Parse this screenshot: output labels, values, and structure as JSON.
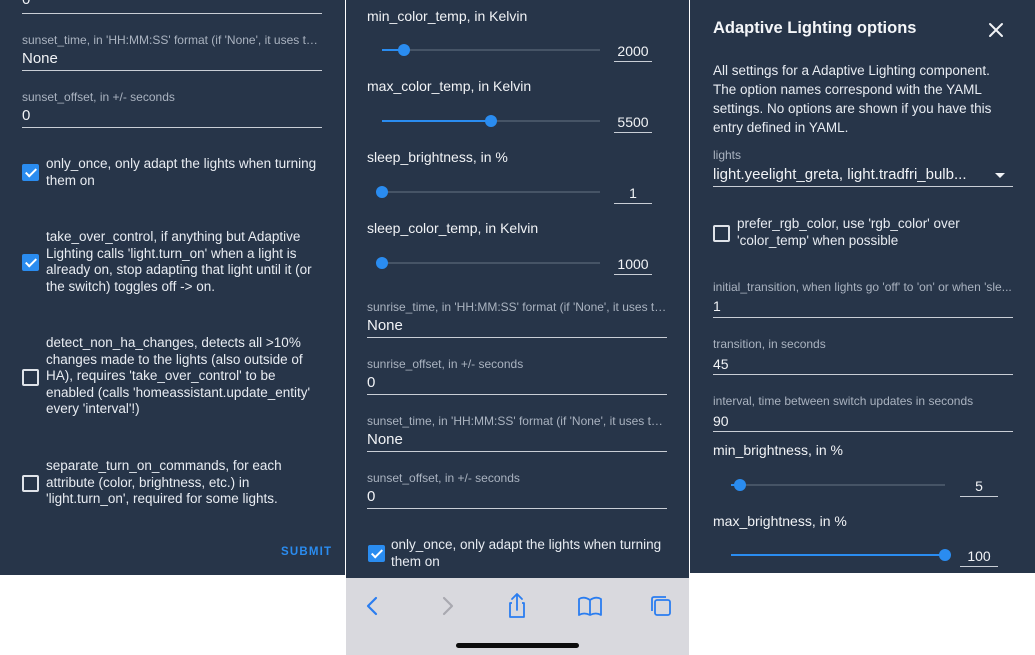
{
  "panel1": {
    "top_value": "0",
    "sunset_time": {
      "label": "sunset_time, in 'HH:MM:SS' format (if 'None', it uses the...",
      "value": "None"
    },
    "sunset_offset": {
      "label": "sunset_offset, in +/- seconds",
      "value": "0"
    },
    "only_once": {
      "checked": true,
      "lines": [
        "only_once, only adapt the lights when turning",
        "them on"
      ]
    },
    "take_over_control": {
      "checked": true,
      "lines": [
        "take_over_control, if anything but Adaptive",
        "Lighting calls 'light.turn_on' when a light is",
        "already on, stop adapting that light until it (or",
        "the switch) toggles off -> on."
      ]
    },
    "detect_non_ha_changes": {
      "checked": false,
      "lines": [
        "detect_non_ha_changes, detects all >10%",
        "changes made to the lights (also outside of",
        "HA), requires 'take_over_control' to be",
        "enabled (calls 'homeassistant.update_entity'",
        "every 'interval'!)"
      ]
    },
    "separate_turn_on_commands": {
      "checked": false,
      "lines": [
        "separate_turn_on_commands, for each",
        "attribute (color, brightness, etc.) in",
        "'light.turn_on', required for some lights."
      ]
    },
    "submit_label": "SUBMIT"
  },
  "panel2": {
    "min_color_temp": {
      "label": "min_color_temp, in Kelvin",
      "value": "2000",
      "fraction": 0.1
    },
    "max_color_temp": {
      "label": "max_color_temp, in Kelvin",
      "value": "5500",
      "fraction": 0.5
    },
    "sleep_brightness": {
      "label": "sleep_brightness, in %",
      "value": "1",
      "fraction": 0.0
    },
    "sleep_color_temp": {
      "label": "sleep_color_temp, in Kelvin",
      "value": "1000",
      "fraction": 0.0
    },
    "sunrise_time": {
      "label": "sunrise_time, in 'HH:MM:SS' format (if 'None', it uses th...",
      "value": "None"
    },
    "sunrise_offset": {
      "label": "sunrise_offset, in +/- seconds",
      "value": "0"
    },
    "sunset_time": {
      "label": "sunset_time, in 'HH:MM:SS' format (if 'None', it uses the...",
      "value": "None"
    },
    "sunset_offset": {
      "label": "sunset_offset, in +/- seconds",
      "value": "0"
    },
    "only_once": {
      "checked": true,
      "lines": [
        "only_once, only adapt the lights when turning",
        "them on"
      ]
    }
  },
  "panel3": {
    "title": "Adaptive Lighting options",
    "description_lines": [
      "All settings for a Adaptive Lighting component.",
      "The option names correspond with the YAML",
      "settings. No options are shown if you have this",
      "entry defined in YAML."
    ],
    "lights": {
      "label": "lights",
      "value": "light.yeelight_greta, light.tradfri_bulb..."
    },
    "prefer_rgb_color": {
      "checked": false,
      "lines": [
        "prefer_rgb_color, use 'rgb_color' over",
        "'color_temp' when possible"
      ]
    },
    "initial_transition": {
      "label": "initial_transition, when lights go 'off' to 'on' or when 'sle...",
      "value": "1"
    },
    "transition": {
      "label": "transition, in seconds",
      "value": "45"
    },
    "interval": {
      "label": "interval, time between switch updates in seconds",
      "value": "90"
    },
    "min_brightness": {
      "label": "min_brightness, in %",
      "value": "5",
      "fraction": 0.04
    },
    "max_brightness": {
      "label": "max_brightness, in %",
      "value": "100",
      "fraction": 1.0
    }
  },
  "browser": {
    "icons": [
      "back-icon",
      "forward-icon",
      "share-icon",
      "bookmarks-icon",
      "tabs-icon"
    ]
  },
  "colors": {
    "panel_bg": "#273549",
    "accent": "#2a8cf0",
    "browser_bar": "#d9d9de"
  }
}
